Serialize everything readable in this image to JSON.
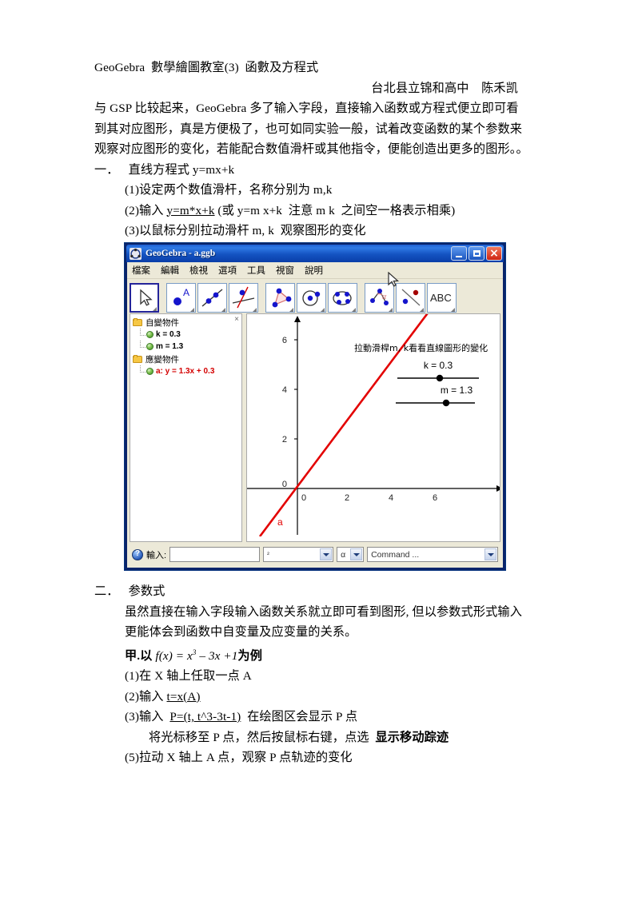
{
  "document": {
    "title_line": "GeoGebra  數學繪圖教室(3)  函數及方程式",
    "byline": "台北县立锦和高中    陈禾凯",
    "intro": [
      "与 GSP 比较起来，GeoGebra 多了输入字段，直接输入函数或方程式便立即可看",
      "到其对应图形，真是方便极了，也可如同实验一般，试着改变函数的某个参数来",
      "观察对应图形的变化，若能配合数值滑杆或其他指令，便能创造出更多的图形。。"
    ],
    "section1": {
      "heading_num": "一．",
      "heading": "直线方程式 y=mx+k",
      "steps": [
        {
          "num": "(1)",
          "text": "设定两个数值滑杆，名称分别为 m,k"
        },
        {
          "num": "(2)",
          "pre": "输入 ",
          "underlined": "y=m*x+k",
          "post": " (或 y=m x+k  注意 m k  之间空一格表示相乘)"
        },
        {
          "num": "(3)",
          "text": "以鼠标分别拉动滑杆 m, k  观察图形的变化"
        }
      ]
    },
    "section2": {
      "heading_num": "二．",
      "heading": "参数式",
      "paragraph": [
        "虽然直接在输入字段输入函数关系就立即可看到图形, 但以参数式形式输入",
        "更能体会到函数中自变量及应变量的关系。"
      ],
      "example_prefix": "甲.以 ",
      "example_formula_f": "f",
      "example_formula_mid": "(x) = x",
      "example_formula_exp": "3",
      "example_formula_tail": " – 3x +1",
      "example_suffix": "为例",
      "steps": [
        {
          "num": "(1)",
          "text": "在 X 轴上任取一点 A"
        },
        {
          "num": "(2)",
          "pre": "输入 ",
          "underlined": "t=x(A)",
          "post": ""
        },
        {
          "num": "(3)",
          "pre": "输入  ",
          "underlined": "P=(t, t^3-3t-1)",
          "post": "  在绘图区会显示 P 点"
        },
        {
          "num": "",
          "pre": "将光标移至 P 点，然后按鼠标右键，点选  ",
          "bold": "显示移动踪迹",
          "post": ""
        },
        {
          "num": "(5)",
          "text": "拉动 X 轴上 A 点，观察 P 点轨迹的变化"
        }
      ]
    }
  },
  "geogebra_window": {
    "title": "GeoGebra - a.ggb",
    "window_buttons": {
      "minimize": "minimize-button",
      "maximize": "maximize-button",
      "close": "close-button"
    },
    "menus": [
      "檔案",
      "編輯",
      "檢視",
      "選項",
      "工具",
      "視窗",
      "說明"
    ],
    "toolbar": [
      {
        "name": "move-tool",
        "selected": true
      },
      {
        "name": "point-tool",
        "selected": false
      },
      {
        "name": "line-through-two-points-tool",
        "selected": false
      },
      {
        "name": "perpendicular-line-tool",
        "selected": false
      },
      {
        "name": "polygon-tool",
        "selected": false
      },
      {
        "name": "circle-tool",
        "selected": false
      },
      {
        "name": "conic-through-five-points-tool",
        "selected": false
      },
      {
        "name": "angle-tool",
        "selected": false
      },
      {
        "name": "reflect-about-line-tool",
        "selected": false
      },
      {
        "name": "text-tool",
        "selected": false,
        "label": "ABC"
      }
    ],
    "algebra_view": {
      "close_label": "×",
      "groups": [
        {
          "label": "自變物件",
          "items": [
            {
              "text": "k = 0.3",
              "color": "#000000"
            },
            {
              "text": "m = 1.3",
              "color": "#000000"
            }
          ]
        },
        {
          "label": "應變物件",
          "items": [
            {
              "text": "a: y = 1.3x + 0.3",
              "color": "#d40000"
            }
          ]
        }
      ]
    },
    "graphics_view": {
      "caption": "拉動滑桿m, k看看直線圖形的變化",
      "sliders": [
        {
          "label": "k = 0.3",
          "value": 0.3
        },
        {
          "label": "m = 1.3",
          "value": 1.3
        }
      ],
      "line_label": "a",
      "line_color": "#e30000",
      "x_ticks": [
        "0",
        "2",
        "4",
        "6"
      ],
      "y_ticks": [
        "0",
        "2",
        "4",
        "6"
      ]
    },
    "input_bar": {
      "help_icon": "help-icon",
      "label": "輸入:",
      "value": "",
      "superscript_value": "²",
      "alpha_value": "α",
      "command_value": "Command ..."
    }
  },
  "chart_data": {
    "type": "line",
    "title": "拉動滑桿m, k看看直線圖形的變化",
    "equation": "y = 1.3x + 0.3",
    "slope": 1.3,
    "intercept": 0.3,
    "xlabel": "",
    "ylabel": "",
    "xlim": [
      -1.6,
      7.6
    ],
    "ylim": [
      -1.2,
      6.8
    ],
    "x_ticks": [
      0,
      2,
      4,
      6
    ],
    "y_ticks": [
      0,
      2,
      4,
      6
    ],
    "grid": false,
    "series": [
      {
        "name": "a",
        "color": "#e30000",
        "points": [
          [
            -1.6,
            -1.78
          ],
          [
            7.6,
            10.18
          ]
        ]
      }
    ]
  }
}
